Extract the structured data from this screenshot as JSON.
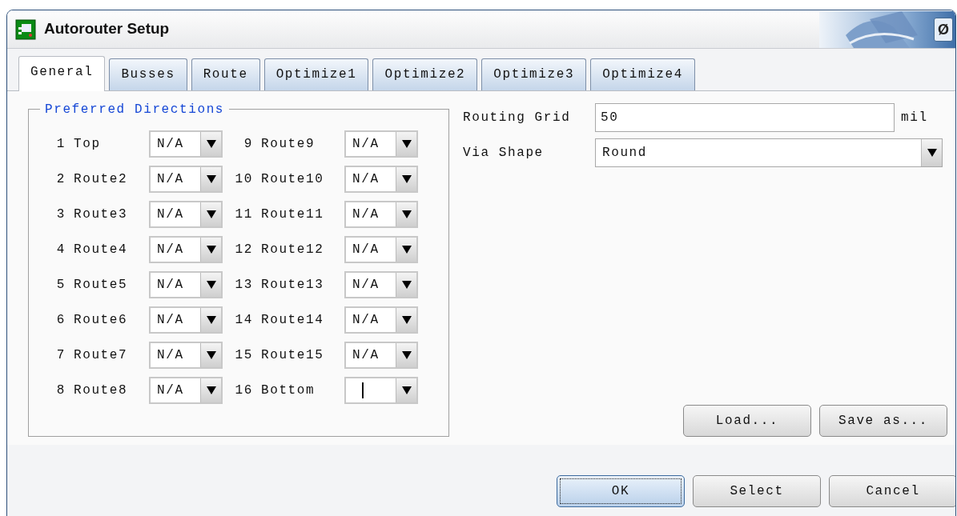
{
  "window": {
    "title": "Autorouter Setup",
    "corner_button": "Ø"
  },
  "tabs": [
    {
      "label": "General",
      "selected": true
    },
    {
      "label": "Busses",
      "selected": false
    },
    {
      "label": "Route",
      "selected": false
    },
    {
      "label": "Optimize1",
      "selected": false
    },
    {
      "label": "Optimize2",
      "selected": false
    },
    {
      "label": "Optimize3",
      "selected": false
    },
    {
      "label": "Optimize4",
      "selected": false
    }
  ],
  "preferred_directions": {
    "title": "Preferred Directions",
    "layers": [
      {
        "number": "1",
        "name": "Top",
        "value": "N/A",
        "focused": false
      },
      {
        "number": "2",
        "name": "Route2",
        "value": "N/A",
        "focused": false
      },
      {
        "number": "3",
        "name": "Route3",
        "value": "N/A",
        "focused": false
      },
      {
        "number": "4",
        "name": "Route4",
        "value": "N/A",
        "focused": false
      },
      {
        "number": "5",
        "name": "Route5",
        "value": "N/A",
        "focused": false
      },
      {
        "number": "6",
        "name": "Route6",
        "value": "N/A",
        "focused": false
      },
      {
        "number": "7",
        "name": "Route7",
        "value": "N/A",
        "focused": false
      },
      {
        "number": "8",
        "name": "Route8",
        "value": "N/A",
        "focused": false
      },
      {
        "number": "9",
        "name": "Route9",
        "value": "N/A",
        "focused": false
      },
      {
        "number": "10",
        "name": "Route10",
        "value": "N/A",
        "focused": false
      },
      {
        "number": "11",
        "name": "Route11",
        "value": "N/A",
        "focused": false
      },
      {
        "number": "12",
        "name": "Route12",
        "value": "N/A",
        "focused": false
      },
      {
        "number": "13",
        "name": "Route13",
        "value": "N/A",
        "focused": false
      },
      {
        "number": "14",
        "name": "Route14",
        "value": "N/A",
        "focused": false
      },
      {
        "number": "15",
        "name": "Route15",
        "value": "N/A",
        "focused": false
      },
      {
        "number": "16",
        "name": "Bottom",
        "focused": true
      }
    ]
  },
  "routing_grid": {
    "label": "Routing Grid",
    "value": "50",
    "unit": "mil"
  },
  "via_shape": {
    "label": "Via Shape",
    "value": "Round"
  },
  "panel_buttons": [
    {
      "label": "Load..."
    },
    {
      "label": "Save as..."
    }
  ],
  "buttons": [
    {
      "label": "OK",
      "default": true
    },
    {
      "label": "Select",
      "default": false
    },
    {
      "label": "Cancel",
      "default": false
    }
  ]
}
